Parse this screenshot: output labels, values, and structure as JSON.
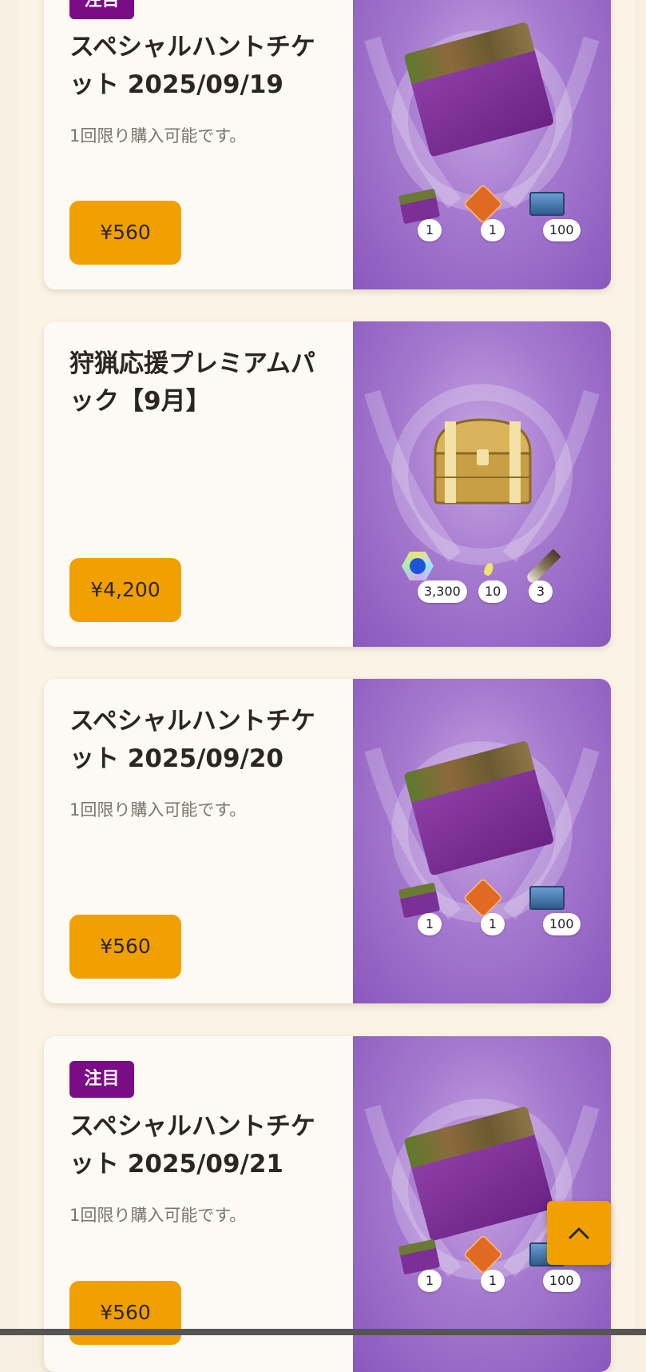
{
  "products": [
    {
      "badge": "注目",
      "title": "スペシャルハントチケット 2025/09/19",
      "note": "1回限り購入可能です。",
      "price": "¥560",
      "art": "ticket",
      "items": [
        {
          "icon": "ticket-icon",
          "count": "1"
        },
        {
          "icon": "orange-gem-icon",
          "count": "1"
        },
        {
          "icon": "supply-box-icon",
          "count": "100"
        }
      ]
    },
    {
      "badge": "",
      "title": "狩猟応援プレミアムパック【9月】",
      "note": "",
      "price": "¥4,200",
      "art": "treasure-chest",
      "items": [
        {
          "icon": "paw-medal-icon",
          "count": "3,300"
        },
        {
          "icon": "spark-icon",
          "count": "10"
        },
        {
          "icon": "knife-icon",
          "count": "3"
        }
      ]
    },
    {
      "badge": "",
      "title": "スペシャルハントチケット 2025/09/20",
      "note": "1回限り購入可能です。",
      "price": "¥560",
      "art": "ticket",
      "items": [
        {
          "icon": "ticket-icon",
          "count": "1"
        },
        {
          "icon": "orange-gem-icon",
          "count": "1"
        },
        {
          "icon": "supply-box-icon",
          "count": "100"
        }
      ]
    },
    {
      "badge": "注目",
      "title": "スペシャルハントチケット 2025/09/21",
      "note": "1回限り購入可能です。",
      "price": "¥560",
      "art": "ticket",
      "items": [
        {
          "icon": "ticket-icon",
          "count": "1"
        },
        {
          "icon": "orange-gem-icon",
          "count": "1"
        },
        {
          "icon": "supply-box-icon",
          "count": "100"
        }
      ]
    }
  ],
  "scroll_top": {
    "icon": "chevron-up-icon"
  },
  "colors": {
    "badge": "#7a0c86",
    "price_button": "#f0a000",
    "card_bg": "#fdf9f3",
    "art_purple": "#a579cf"
  }
}
